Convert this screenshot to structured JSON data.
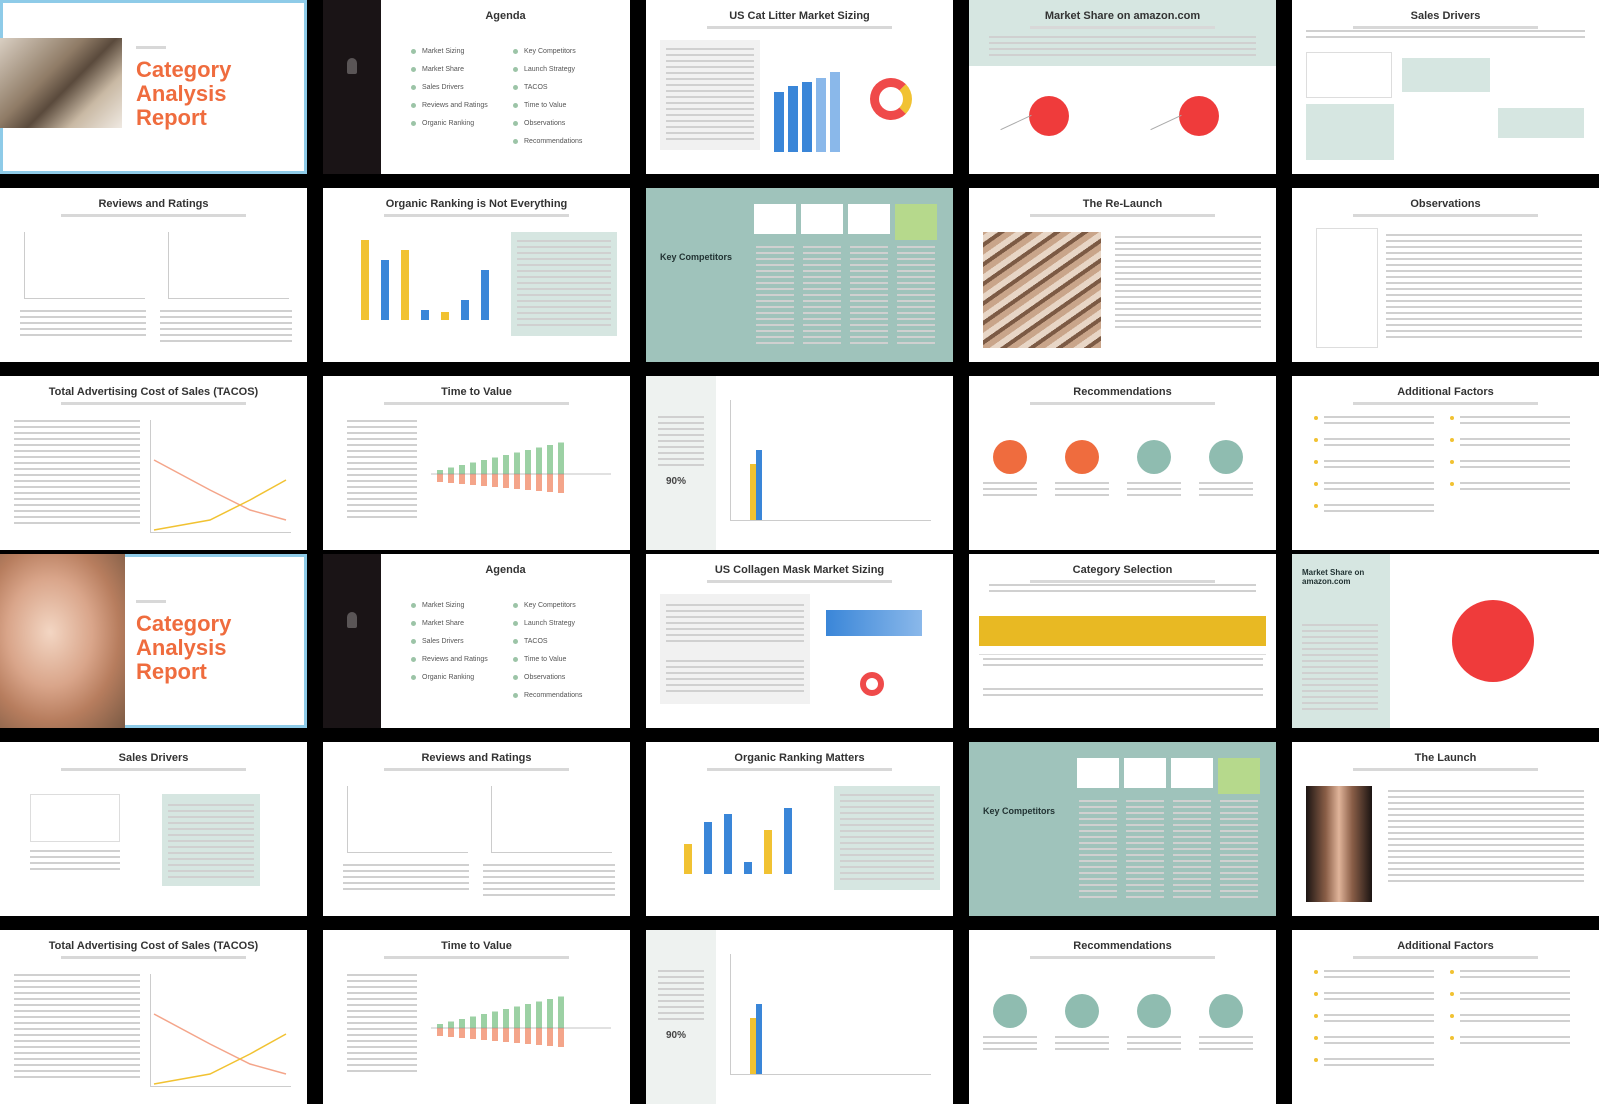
{
  "app": {
    "view": "slide-sorter"
  },
  "slides": [
    {
      "id": 1,
      "kind": "cover",
      "eyebrow": "",
      "title": "Category Analysis Report",
      "photo": "cat-photo"
    },
    {
      "id": 2,
      "kind": "agenda",
      "title": "Agenda",
      "left_items": [
        "Market Sizing",
        "Market Share",
        "Sales Drivers",
        "Reviews and Ratings",
        "Organic Ranking"
      ],
      "right_items": [
        "Key Competitors",
        "Launch Strategy",
        "TACOS",
        "Time to Value",
        "Observations",
        "Recommendations"
      ]
    },
    {
      "id": 3,
      "kind": "market",
      "title": "US Cat Litter Market Sizing"
    },
    {
      "id": 4,
      "kind": "pies-header",
      "title": "Market Share on amazon.com"
    },
    {
      "id": 5,
      "kind": "drivers",
      "title": "Sales Drivers"
    },
    {
      "id": 6,
      "kind": "two-charts",
      "title": "Reviews and Ratings"
    },
    {
      "id": 7,
      "kind": "bars-note",
      "title": "Organic Ranking is Not Everything"
    },
    {
      "id": 8,
      "kind": "competition",
      "title": "Key Competitors"
    },
    {
      "id": 9,
      "kind": "photo-text",
      "title": "The Re-Launch",
      "photo": "architecture-photo"
    },
    {
      "id": 10,
      "kind": "table-text",
      "title": "Observations"
    },
    {
      "id": 11,
      "kind": "line-text",
      "title": "Total Advertising Cost of Sales (TACOS)"
    },
    {
      "id": 12,
      "kind": "time-value",
      "title": "Time to Value"
    },
    {
      "id": 13,
      "kind": "pareto",
      "title": "",
      "stat": "90%"
    },
    {
      "id": 14,
      "kind": "recs-orange",
      "title": "Recommendations"
    },
    {
      "id": 15,
      "kind": "factors",
      "title": "Additional Factors"
    },
    {
      "id": 16,
      "kind": "cover",
      "eyebrow": "",
      "title": "Category Analysis Report",
      "photo": "portrait-photo"
    },
    {
      "id": 17,
      "kind": "agenda",
      "title": "Agenda",
      "left_items": [
        "Market Sizing",
        "Market Share",
        "Sales Drivers",
        "Reviews and Ratings",
        "Organic Ranking"
      ],
      "right_items": [
        "Key Competitors",
        "Launch Strategy",
        "TACOS",
        "Time to Value",
        "Observations",
        "Recommendations"
      ]
    },
    {
      "id": 18,
      "kind": "market2",
      "title": "US Collagen Mask Market Sizing"
    },
    {
      "id": 19,
      "kind": "yellow-table",
      "title": "Category Selection"
    },
    {
      "id": 20,
      "kind": "side-pie",
      "title": "",
      "side_title": "Market Share on amazon.com"
    },
    {
      "id": 21,
      "kind": "drivers2",
      "title": "Sales Drivers"
    },
    {
      "id": 22,
      "kind": "two-charts",
      "title": "Reviews and Ratings"
    },
    {
      "id": 23,
      "kind": "bars-note",
      "title": "Organic Ranking Matters"
    },
    {
      "id": 24,
      "kind": "competition",
      "title": "Key Competitors"
    },
    {
      "id": 25,
      "kind": "photo-text",
      "title": "The Launch",
      "photo": "portrait-photo-2"
    },
    {
      "id": 26,
      "kind": "line-text",
      "title": "Total Advertising Cost of Sales (TACOS)"
    },
    {
      "id": 27,
      "kind": "time-value",
      "title": "Time to Value"
    },
    {
      "id": 28,
      "kind": "pareto",
      "title": "",
      "stat": "90%"
    },
    {
      "id": 29,
      "kind": "recs-teal",
      "title": "Recommendations"
    },
    {
      "id": 30,
      "kind": "factors",
      "title": "Additional Factors"
    }
  ]
}
